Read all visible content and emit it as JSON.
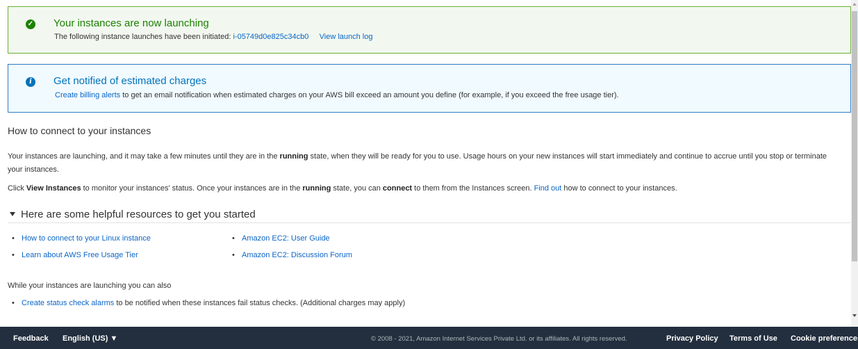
{
  "success_alert": {
    "title": "Your instances are now launching",
    "message_prefix": "The following instance launches have been initiated:",
    "instance_id": "i-05749d0e825c34cb0",
    "view_log": "View launch log",
    "icon": "check-circle-icon",
    "color": "#1d8102"
  },
  "info_alert": {
    "title": "Get notified of estimated charges",
    "link": "Create billing alerts",
    "message": "to get an email notification when estimated charges on your AWS bill exceed an amount you define (for example, if you exceed the free usage tier).",
    "icon": "info-circle-icon",
    "color": "#0073bb"
  },
  "connect": {
    "title": "How to connect to your instances",
    "p1_a": "Your instances are launching, and it may take a few minutes until they are in the ",
    "p1_bold": "running",
    "p1_b": " state, when they will be ready for you to use. Usage hours on your new instances will start immediately and continue to accrue until you stop or terminate your instances.",
    "p2_a": "Click ",
    "p2_bold1": "View Instances",
    "p2_b": " to monitor your instances' status. Once your instances are in the ",
    "p2_bold2": "running",
    "p2_c": " state, you can ",
    "p2_bold3": "connect",
    "p2_d": " to them from the Instances screen. ",
    "p2_link": "Find out",
    "p2_e": " how to connect to your instances."
  },
  "resources": {
    "title": "Here are some helpful resources to get you started",
    "col1": [
      "How to connect to your Linux instance",
      "Learn about AWS Free Usage Tier"
    ],
    "col2": [
      "Amazon EC2: User Guide",
      "Amazon EC2: Discussion Forum"
    ]
  },
  "also": {
    "title": "While your instances are launching you can also",
    "alarm_link": "Create status check alarms",
    "alarm_text": " to be notified when these instances fail status checks. (Additional charges may apply)"
  },
  "footer": {
    "feedback": "Feedback",
    "language": "English (US) ▼",
    "copyright": "© 2008 - 2021, Amazon Internet Services Private Ltd. or its affiliates. All rights reserved.",
    "privacy": "Privacy Policy",
    "terms": "Terms of Use",
    "cookies": "Cookie preferences"
  }
}
